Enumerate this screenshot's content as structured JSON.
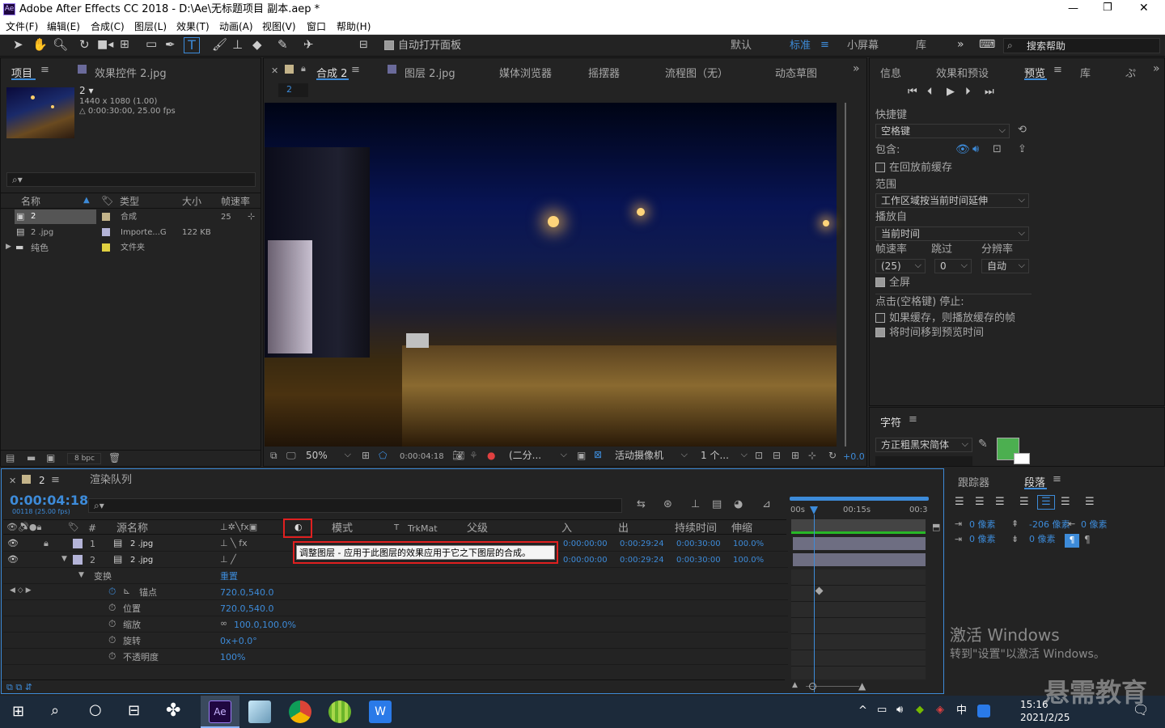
{
  "window": {
    "title": "Adobe After Effects CC 2018 - D:\\Ae\\无标题项目 副本.aep *",
    "app_icon": "Ae",
    "min": "—",
    "max": "❐",
    "close": "✕"
  },
  "menu": [
    "文件(F)",
    "编辑(E)",
    "合成(C)",
    "图层(L)",
    "效果(T)",
    "动画(A)",
    "视图(V)",
    "窗口",
    "帮助(H)"
  ],
  "toolbar": {
    "auto_open": "自动打开面板",
    "workspaces": [
      "默认",
      "标准",
      "小屏幕",
      "库"
    ],
    "active_ws": "标准",
    "more": "»",
    "search_placeholder": "搜索帮助"
  },
  "project": {
    "tab": "项目",
    "tab2": "效果控件 2.jpg",
    "comp_name": "2 ▾",
    "comp_info1": "1440 x 1080 (1.00)",
    "comp_info2": "△ 0:00:30:00, 25.00 fps",
    "headers": [
      "名称",
      "类型",
      "大小",
      "帧速率"
    ],
    "rows": [
      {
        "name": "2",
        "type": "合成",
        "size": "",
        "fps": "25"
      },
      {
        "name": "2 .jpg",
        "type": "Importe...G",
        "size": "122 KB",
        "fps": ""
      },
      {
        "name": "纯色",
        "type": "文件夹",
        "size": "",
        "fps": ""
      }
    ],
    "bpc": "8 bpc"
  },
  "comp_tabs": [
    "合成 2",
    "图层 2.jpg",
    "媒体浏览器",
    "摇摆器",
    "流程图（无）",
    "动态草图"
  ],
  "comp_tab_small": "2",
  "viewer_bar": {
    "zoom": "50%",
    "time": "0:00:04:18",
    "res": "(二分...",
    "camera": "活动摄像机",
    "views": "1 个...",
    "exposure": "+0.0"
  },
  "right_tabs": [
    "信息",
    "效果和预设",
    "预览",
    "库",
    "ぷ"
  ],
  "preview": {
    "shortcut_label": "快捷键",
    "shortcut": "空格键",
    "include": "包含:",
    "cache_before": "在回放前缓存",
    "range_label": "范围",
    "range": "工作区域按当前时间延伸",
    "play_from_label": "播放自",
    "play_from": "当前时间",
    "fps_label": "帧速率",
    "skip_label": "跳过",
    "res_label": "分辨率",
    "fps": "(25)",
    "skip": "0",
    "res": "自动",
    "fullscreen": "全屏",
    "stop_label": "点击(空格键) 停止:",
    "opt1": "如果缓存，则播放缓存的帧",
    "opt2": "将时间移到预览时间"
  },
  "char": {
    "tab": "字符",
    "font": "方正粗黑宋简体"
  },
  "para": {
    "tab1": "跟踪器",
    "tab2": "段落",
    "v1": "0 像素",
    "v2": "-206 像素",
    "v3": "0 像素",
    "v4": "0 像素",
    "v5": "0 像素"
  },
  "timeline": {
    "tab": "2",
    "tab2": "渲染队列",
    "time": "0:00:04:18",
    "frames": "00118 (25.00 fps)",
    "cols": {
      "num": "#",
      "src": "源名称",
      "mode": "模式",
      "t": "T",
      "trkmat": "TrkMat",
      "parent": "父级",
      "in": "入",
      "out": "出",
      "dur": "持续时间",
      "stretch": "伸缩"
    },
    "layers": [
      {
        "num": "1",
        "name": "2 .jpg",
        "in": "0:00:00:00",
        "out": "0:00:29:24",
        "dur": "0:00:30:00",
        "stretch": "100.0%"
      },
      {
        "num": "2",
        "name": "2 .jpg",
        "in": "0:00:00:00",
        "out": "0:00:29:24",
        "dur": "0:00:30:00",
        "stretch": "100.0%"
      }
    ],
    "transform": "变换",
    "reset": "重置",
    "props": [
      {
        "name": "锚点",
        "val": "720.0,540.0"
      },
      {
        "name": "位置",
        "val": "720.0,540.0"
      },
      {
        "name": "缩放",
        "val": "100.0,100.0%"
      },
      {
        "name": "旋转",
        "val": "0x+0.0°"
      },
      {
        "name": "不透明度",
        "val": "100%"
      }
    ],
    "ruler": [
      "00s",
      "00:15s",
      "00:3"
    ],
    "tooltip": "调整图层 - 应用于此图层的效果应用于它之下图层的合成。"
  },
  "watermark": {
    "line1": "激活 Windows",
    "line2": "转到\"设置\"以激活 Windows。",
    "brand": "悬需教育"
  },
  "taskbar": {
    "time": "15:16",
    "date": "2021/2/25",
    "ime": "中"
  },
  "colors": {
    "accent": "#3d8bd9",
    "swatch": "#4caf50",
    "highlight": "#e02020"
  }
}
